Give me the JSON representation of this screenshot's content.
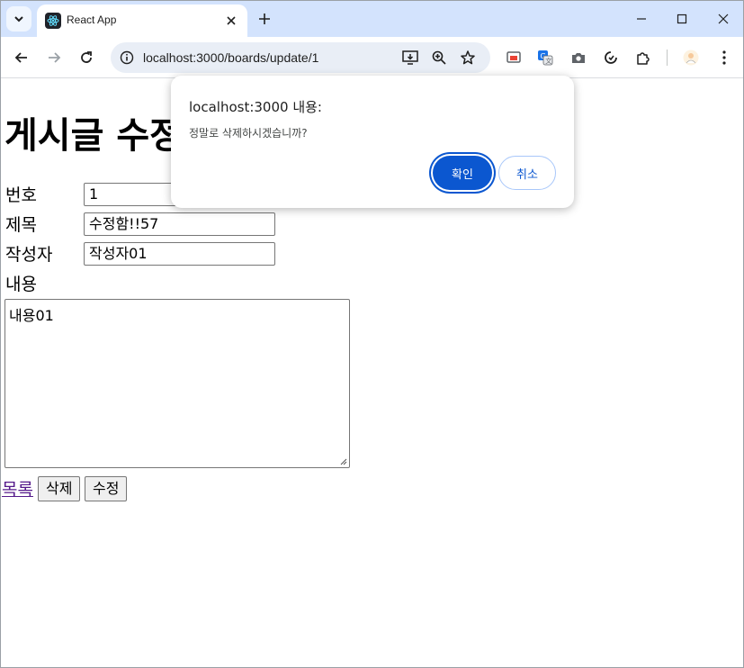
{
  "browser": {
    "tab_title": "React App",
    "url": "localhost:3000/boards/update/1",
    "icons": {
      "tab_search": "chevron-down-icon",
      "favicon": "react-logo-icon",
      "tab_close": "close-icon",
      "new_tab": "plus-icon",
      "minimize": "minimize-icon",
      "maximize": "maximize-icon",
      "close_window": "close-icon",
      "back": "arrow-left-icon",
      "forward": "arrow-right-icon",
      "reload": "reload-icon",
      "site_info": "tune-icon",
      "install": "install-app-icon",
      "zoom": "zoom-in-icon",
      "bookmark": "star-icon",
      "cast": "cast-icon",
      "translate": "translate-icon",
      "screenshot": "camera-icon",
      "sync": "sync-icon",
      "extensions": "puzzle-icon",
      "profile": "avatar-icon",
      "menu": "kebab-menu-icon"
    },
    "colors": {
      "tabstrip": "#d3e3fd",
      "omnibox": "#e9eef6",
      "accent": "#0b57d0"
    }
  },
  "page": {
    "title": "게시글 수정",
    "fields": {
      "number": {
        "label": "번호",
        "value": "1"
      },
      "subject": {
        "label": "제목",
        "value": "수정함!!57"
      },
      "author": {
        "label": "작성자",
        "value": "작성자01"
      },
      "content": {
        "label": "내용",
        "value": "내용01"
      }
    },
    "actions": {
      "list_link": "목록",
      "delete_label": "삭제",
      "update_label": "수정"
    }
  },
  "dialog": {
    "title": "localhost:3000 내용:",
    "message": "정말로 삭제하시겠습니까?",
    "ok_label": "확인",
    "cancel_label": "취소"
  }
}
